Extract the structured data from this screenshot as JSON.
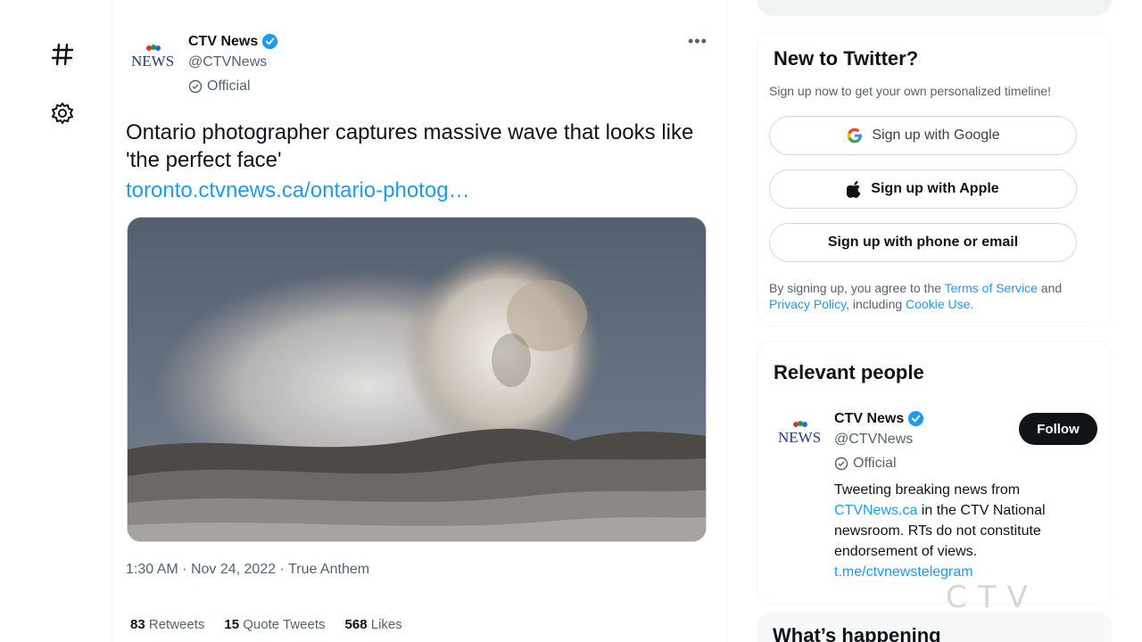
{
  "nav": {
    "icons": [
      "twitter-bird-icon",
      "hashtag-icon",
      "gear-icon"
    ]
  },
  "tweet": {
    "author_name": "CTV News",
    "author_handle": "@CTVNews",
    "official_label": "Official",
    "logo_text": "NEWS",
    "text": "Ontario photographer captures massive wave that looks like 'the perfect face'",
    "link": "toronto.ctvnews.ca/ontario-photog…",
    "time": "1:30 AM",
    "date": "Nov 24, 2022",
    "source": "True Anthem",
    "retweets_count": "83",
    "retweets_label": "Retweets",
    "quotes_count": "15",
    "quotes_label": "Quote Tweets",
    "likes_count": "568",
    "likes_label": "Likes"
  },
  "signup": {
    "title": "New to Twitter?",
    "subtitle": "Sign up now to get your own personalized timeline!",
    "google_label": "Sign up with Google",
    "apple_label": "Sign up with Apple",
    "phone_label": "Sign up with phone or email",
    "terms_prefix": "By signing up, you agree to the ",
    "terms_link": "Terms of Service",
    "terms_and": " and",
    "privacy_link": "Privacy Policy",
    "including": ", including ",
    "cookie_link": "Cookie Use."
  },
  "people": {
    "title": "Relevant people",
    "name": "CTV News",
    "handle": "@CTVNews",
    "official_label": "Official",
    "follow_label": "Follow",
    "bio_1": "Tweeting breaking news from ",
    "bio_link": "CTVNews.ca",
    "bio_2": " in the CTV National newsroom. RTs do not constitute endorsement of views.",
    "bio_url": "t.me/ctvnewstelegram"
  },
  "happening": {
    "title": "What’s happening"
  },
  "watermark": "CTV",
  "colors": {
    "accent": "#1d9bf0",
    "text": "#0f1419",
    "muted": "#536471"
  }
}
